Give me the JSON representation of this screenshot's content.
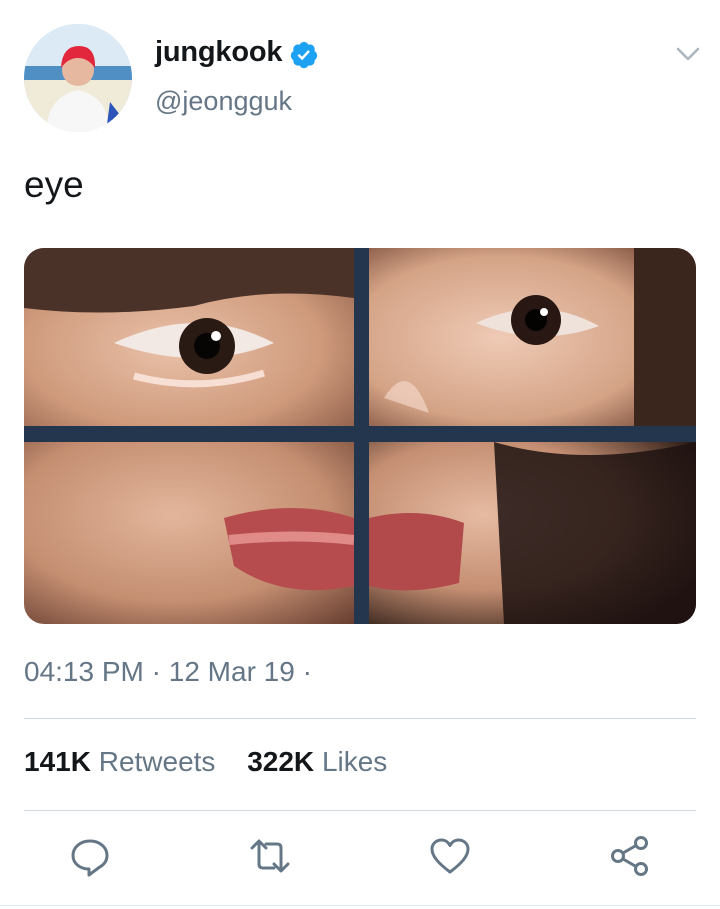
{
  "user": {
    "display_name": "jungkook",
    "handle": "@jeongguk",
    "verified": true,
    "avatar_icon": "profile-photo"
  },
  "tweet": {
    "text": "eye",
    "media_icon": "face-collage-photo"
  },
  "meta": {
    "time": "04:13 PM",
    "separator": "·",
    "date": "12 Mar 19",
    "trailing": "·"
  },
  "stats": {
    "retweets_count": "141K",
    "retweets_label": "Retweets",
    "likes_count": "322K",
    "likes_label": "Likes"
  },
  "actions": [
    "reply-icon",
    "retweet-icon",
    "like-icon",
    "share-icon"
  ],
  "colors": {
    "verified_blue": "#1da1f2",
    "secondary_text": "#657786",
    "primary_text": "#14171a",
    "divider": "#cfd9de"
  }
}
